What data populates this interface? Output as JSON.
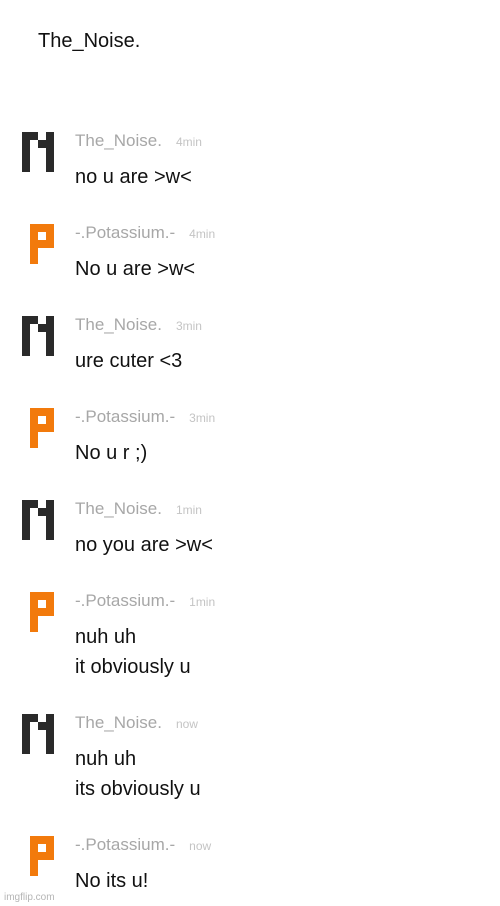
{
  "header": {
    "title": "The_Noise."
  },
  "avatars": {
    "noise": {
      "letter": "N",
      "color": "#2a2a2a",
      "icon": "pixel-n-icon"
    },
    "potassium": {
      "letter": "P",
      "color": "#f27a0c",
      "icon": "pixel-p-icon"
    }
  },
  "messages": [
    {
      "author": "The_Noise.",
      "time": "4min",
      "lines": [
        "no u are >w<"
      ]
    },
    {
      "author": "-.Potassium.-",
      "time": "4min",
      "lines": [
        "No u are >w<"
      ]
    },
    {
      "author": "The_Noise.",
      "time": "3min",
      "lines": [
        "ure cuter <3"
      ]
    },
    {
      "author": "-.Potassium.-",
      "time": "3min",
      "lines": [
        "No u r ;)"
      ]
    },
    {
      "author": "The_Noise.",
      "time": "1min",
      "lines": [
        "no you are >w<"
      ]
    },
    {
      "author": "-.Potassium.-",
      "time": "1min",
      "lines": [
        "nuh uh",
        "it obviously u"
      ]
    },
    {
      "author": "The_Noise.",
      "time": "now",
      "lines": [
        "nuh uh",
        "its obviously u"
      ]
    },
    {
      "author": "-.Potassium.-",
      "time": "now",
      "lines": [
        "No its u!"
      ]
    }
  ],
  "watermark": "imgflip.com"
}
